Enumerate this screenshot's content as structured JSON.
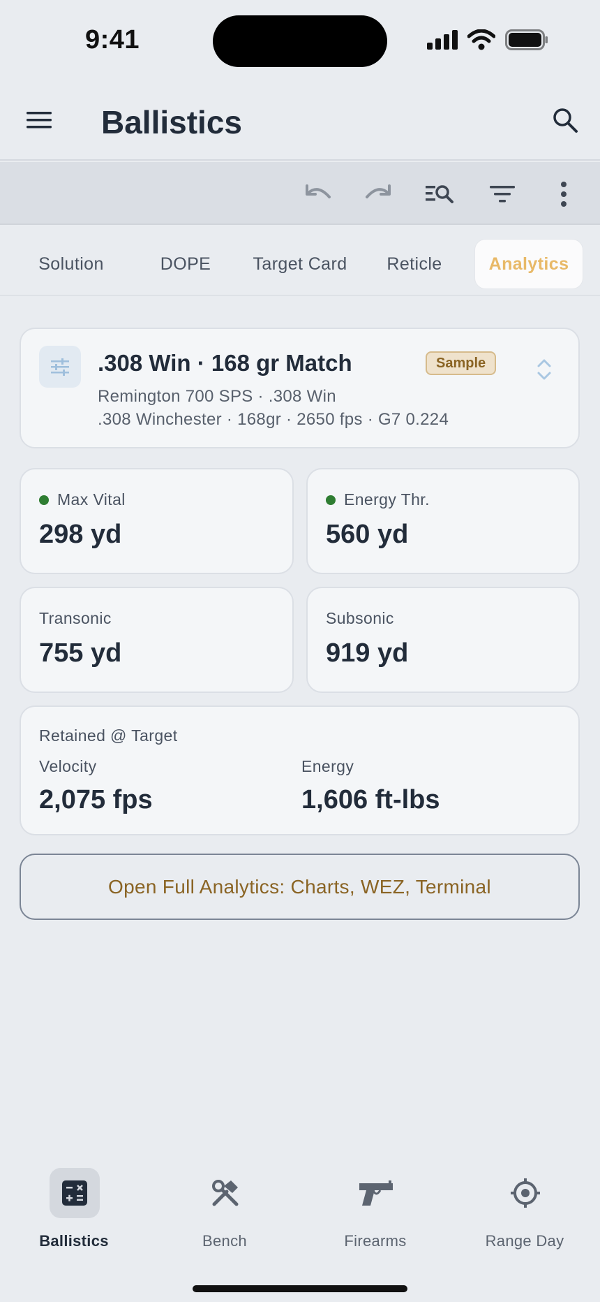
{
  "status_bar": {
    "time": "9:41"
  },
  "app_bar": {
    "title": "Ballistics"
  },
  "tabs": [
    {
      "label": "Solution",
      "active": false
    },
    {
      "label": "DOPE",
      "active": false
    },
    {
      "label": "Target Card",
      "active": false
    },
    {
      "label": "Reticle",
      "active": false
    },
    {
      "label": "Analytics",
      "active": true
    }
  ],
  "profile": {
    "name": ".308 Win · 168 gr Match",
    "badge": "Sample",
    "rifle": "Remington 700 SPS · .308 Win",
    "load": ".308 Winchester · 168gr · 2650 fps · G7 0.224"
  },
  "stats": [
    {
      "label": "Max Vital",
      "value": "298 yd",
      "indicator": "green"
    },
    {
      "label": "Energy Thr.",
      "value": "560 yd",
      "indicator": "green"
    },
    {
      "label": "Transonic",
      "value": "755 yd"
    },
    {
      "label": "Subsonic",
      "value": "919 yd"
    }
  ],
  "retained": {
    "heading": "Retained @ Target",
    "velocity_label": "Velocity",
    "velocity_value": "2,075 fps",
    "energy_label": "Energy",
    "energy_value": "1,606 ft-lbs"
  },
  "full_analytics_button": "Open Full Analytics: Charts, WEZ, Terminal",
  "bottom_nav": [
    {
      "label": "Ballistics",
      "icon": "calculator-icon",
      "active": true
    },
    {
      "label": "Bench",
      "icon": "tools-icon",
      "active": false
    },
    {
      "label": "Firearms",
      "icon": "pistol-icon",
      "active": false
    },
    {
      "label": "Range Day",
      "icon": "target-icon",
      "active": false
    }
  ],
  "colors": {
    "accent": "#e8b968",
    "accent_dark": "#8a6424",
    "status_green": "#2e7d32",
    "text": "#222c3a"
  }
}
